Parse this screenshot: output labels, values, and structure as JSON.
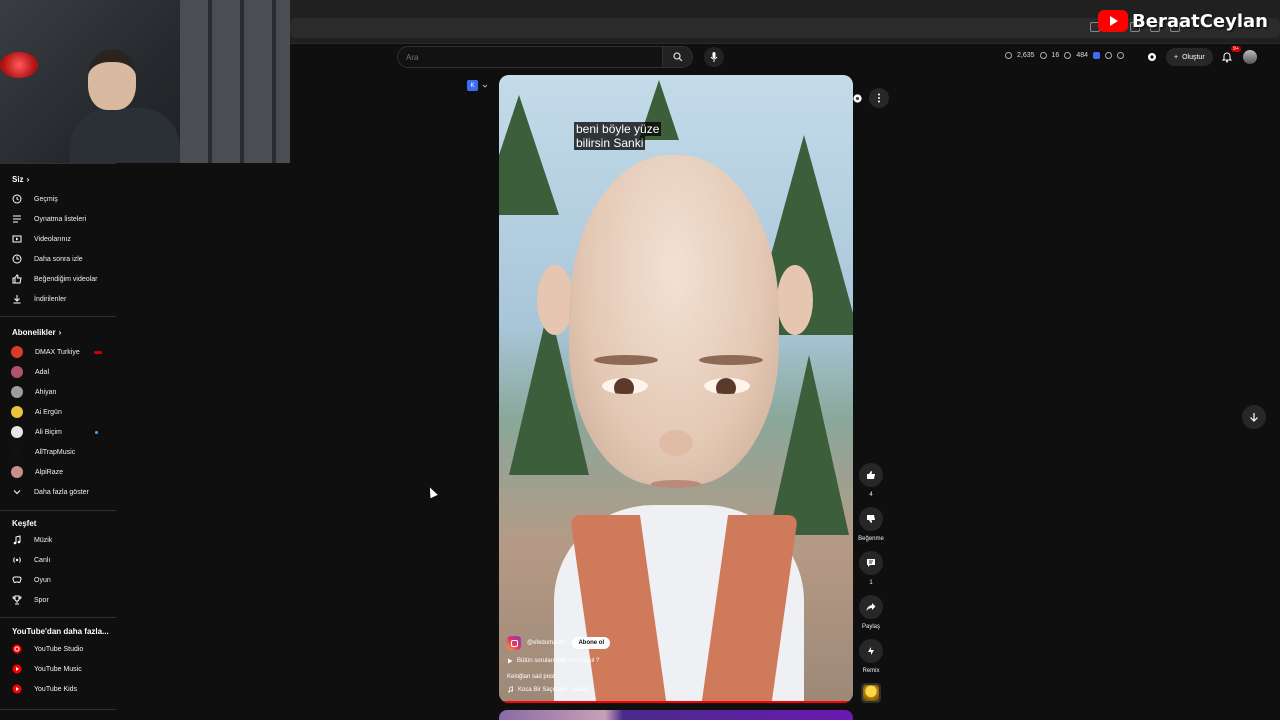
{
  "watermark": {
    "channel": "BeraatCeylan"
  },
  "masthead": {
    "search_placeholder": "Ara",
    "stats": {
      "views": "2,635",
      "subs": "16",
      "other": "484"
    },
    "create_label": "Oluştur",
    "notifications_badge": "9+"
  },
  "sidebar": {
    "you": {
      "title": "Siz",
      "items": [
        {
          "label": "Geçmiş",
          "icon": "history-icon"
        },
        {
          "label": "Oynatma listeleri",
          "icon": "playlists-icon"
        },
        {
          "label": "Videolarınız",
          "icon": "your-videos-icon"
        },
        {
          "label": "Daha sonra izle",
          "icon": "watch-later-icon"
        },
        {
          "label": "Beğendiğim videolar",
          "icon": "liked-icon"
        },
        {
          "label": "İndirilenler",
          "icon": "download-icon"
        }
      ]
    },
    "subscriptions": {
      "title": "Abonelikler",
      "items": [
        {
          "label": "DMAX Turkiye",
          "color": "#d83b2b",
          "status": "live"
        },
        {
          "label": "Adal",
          "color": "#b0536a",
          "status": ""
        },
        {
          "label": "Ahiyan",
          "color": "#9d9d9d",
          "status": ""
        },
        {
          "label": "Ai Ergün",
          "color": "#e8c33d",
          "status": ""
        },
        {
          "label": "Ali Biçim",
          "color": "#e6e6e6",
          "status": "new"
        },
        {
          "label": "AllTrapMusic",
          "color": "#111111",
          "status": ""
        },
        {
          "label": "AlpiRaze",
          "color": "#c98f8f",
          "status": ""
        }
      ],
      "show_more": "Daha fazla göster"
    },
    "explore": {
      "title": "Keşfet",
      "items": [
        {
          "label": "Müzik",
          "icon": "music-icon"
        },
        {
          "label": "Canlı",
          "icon": "live-icon"
        },
        {
          "label": "Oyun",
          "icon": "gaming-icon"
        },
        {
          "label": "Spor",
          "icon": "trophy-icon"
        }
      ]
    },
    "more": {
      "title": "YouTube'dan daha fazla...",
      "items": [
        {
          "label": "YouTube Studio"
        },
        {
          "label": "YouTube Music"
        },
        {
          "label": "YouTube Kids"
        }
      ]
    }
  },
  "short": {
    "caption_line1": "beni böyle yüze",
    "caption_line2": "bilirsin Sanki",
    "channel_handle": "@efeduman00",
    "subscribe_label": "Abone ol",
    "playlist_text": "Bütün soruları bildi ama nasıl ?",
    "description": "Keloğlan sad post...",
    "music": "Koca Bir Saçmalık · Jakuzi",
    "progress": 1.0
  },
  "actions": {
    "like_count": "4",
    "dislike_label": "Beğenme",
    "comment_count": "1",
    "share_label": "Paylaş",
    "remix_label": "Remix"
  },
  "colors": {
    "accent_red": "#ff0000",
    "background": "#0f0f0f",
    "button_bg": "#272727"
  }
}
